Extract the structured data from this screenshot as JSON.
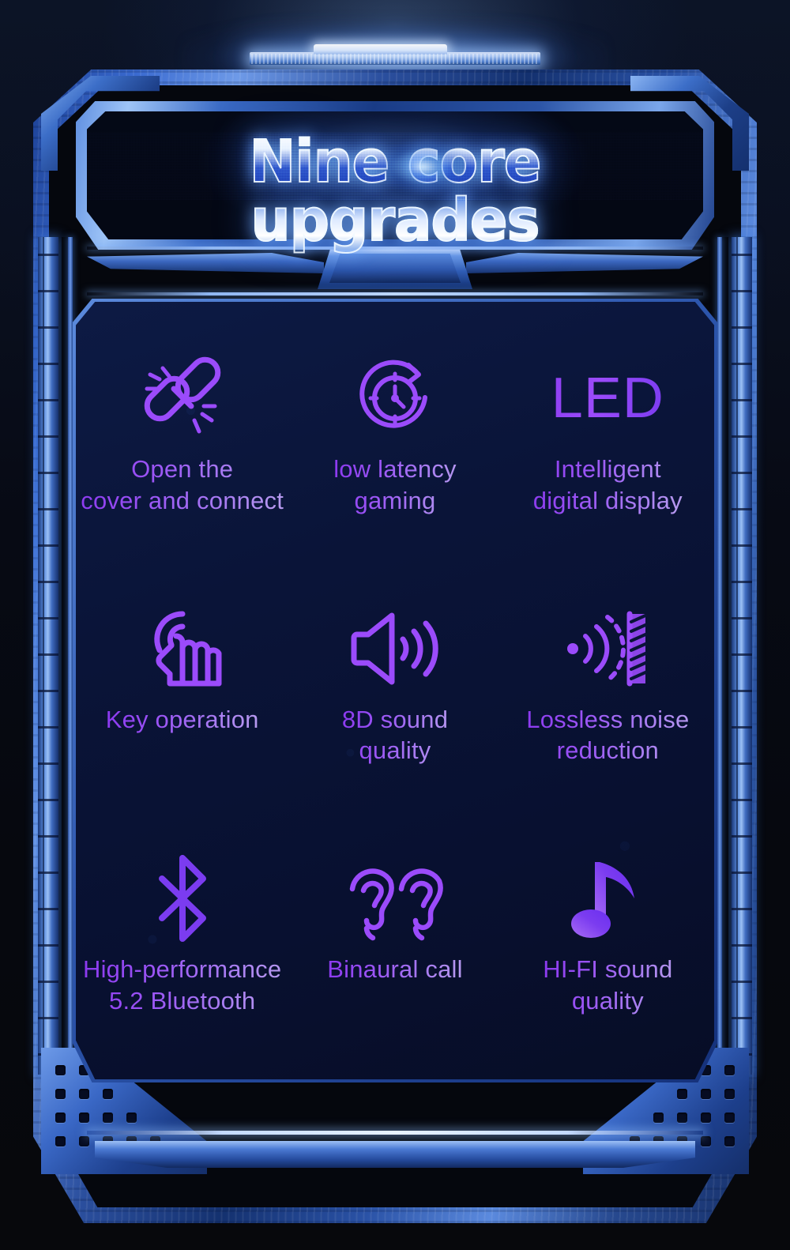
{
  "header": {
    "title": "Nine core upgrades",
    "accent_blue": "#3a6ad0",
    "panel_navy": "#0a1438",
    "accent_purple": "#9b4bfb"
  },
  "decor": {
    "top_light_bar": "top-light-bar",
    "divider": "divider-bar",
    "bottom_bar": "bottom-bar"
  },
  "features": [
    {
      "icon": "broken-link-connect-icon",
      "label": "Open the\ncover and connect"
    },
    {
      "icon": "clock-refresh-latency-icon",
      "label": "low latency\ngaming"
    },
    {
      "icon": "led-text-icon",
      "icon_text": "LED",
      "label": "Intelligent\ndigital display"
    },
    {
      "icon": "touch-hand-icon",
      "label": "Key operation"
    },
    {
      "icon": "speaker-volume-icon",
      "label": "8D sound\nquality"
    },
    {
      "icon": "noise-reduction-barrier-icon",
      "label": "Lossless noise\nreduction"
    },
    {
      "icon": "bluetooth-icon",
      "label": "High-performance\n5.2 Bluetooth"
    },
    {
      "icon": "two-ears-icon",
      "label": "Binaural call"
    },
    {
      "icon": "music-note-icon",
      "label": "HI-FI sound\nquality"
    }
  ]
}
